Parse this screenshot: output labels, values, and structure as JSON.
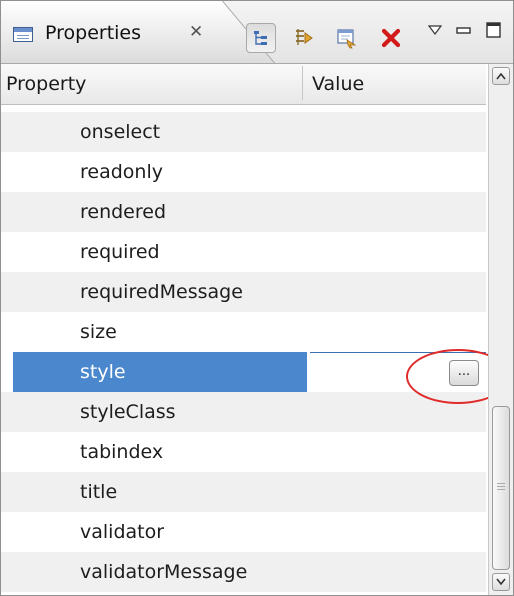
{
  "view": {
    "title": "Properties",
    "close_glyph": "✕"
  },
  "toolbar": {
    "buttons": [
      {
        "name": "show-categories-icon",
        "pressed": true
      },
      {
        "name": "show-advanced-icon",
        "pressed": false
      },
      {
        "name": "restore-default-icon",
        "pressed": false
      },
      {
        "name": "remove-property-icon",
        "pressed": false
      }
    ],
    "view_menu": [
      "view-menu-icon",
      "minimize-icon",
      "maximize-icon"
    ]
  },
  "table": {
    "headers": {
      "property": "Property",
      "value": "Value"
    },
    "rows": [
      {
        "name": "onselect",
        "value": ""
      },
      {
        "name": "readonly",
        "value": ""
      },
      {
        "name": "rendered",
        "value": ""
      },
      {
        "name": "required",
        "value": ""
      },
      {
        "name": "requiredMessage",
        "value": ""
      },
      {
        "name": "size",
        "value": ""
      },
      {
        "name": "style",
        "value": "",
        "selected": true,
        "edit_button": "..."
      },
      {
        "name": "styleClass",
        "value": ""
      },
      {
        "name": "tabindex",
        "value": ""
      },
      {
        "name": "title",
        "value": ""
      },
      {
        "name": "validator",
        "value": ""
      },
      {
        "name": "validatorMessage",
        "value": ""
      }
    ]
  },
  "colors": {
    "selection": "#4a87cd",
    "alternate_row": "#f0f0f0",
    "highlight_circle": "#e02b2b"
  }
}
